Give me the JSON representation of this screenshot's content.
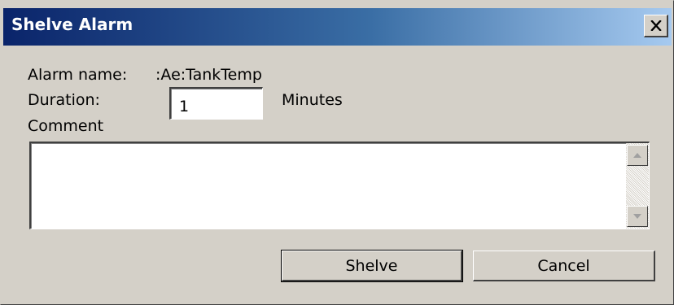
{
  "window": {
    "title": "Shelve Alarm",
    "close_glyph": "×",
    "close_icon": "close-icon",
    "title_gradient_colors": [
      "#0a246a",
      "#3a6ea5",
      "#a6caf0"
    ],
    "face_color": "#d4d0c8"
  },
  "form": {
    "alarm_name_label": "Alarm name:",
    "alarm_name_value": ":Ae:TankTemp",
    "duration_label": "Duration:",
    "duration_value": "1",
    "duration_unit": "Minutes",
    "comment_label": "Comment",
    "comment_value": "",
    "scroll_up_icon": "scroll-up-arrow-icon",
    "scroll_down_icon": "scroll-down-arrow-icon"
  },
  "buttons": {
    "shelve_label": "Shelve",
    "cancel_label": "Cancel"
  }
}
